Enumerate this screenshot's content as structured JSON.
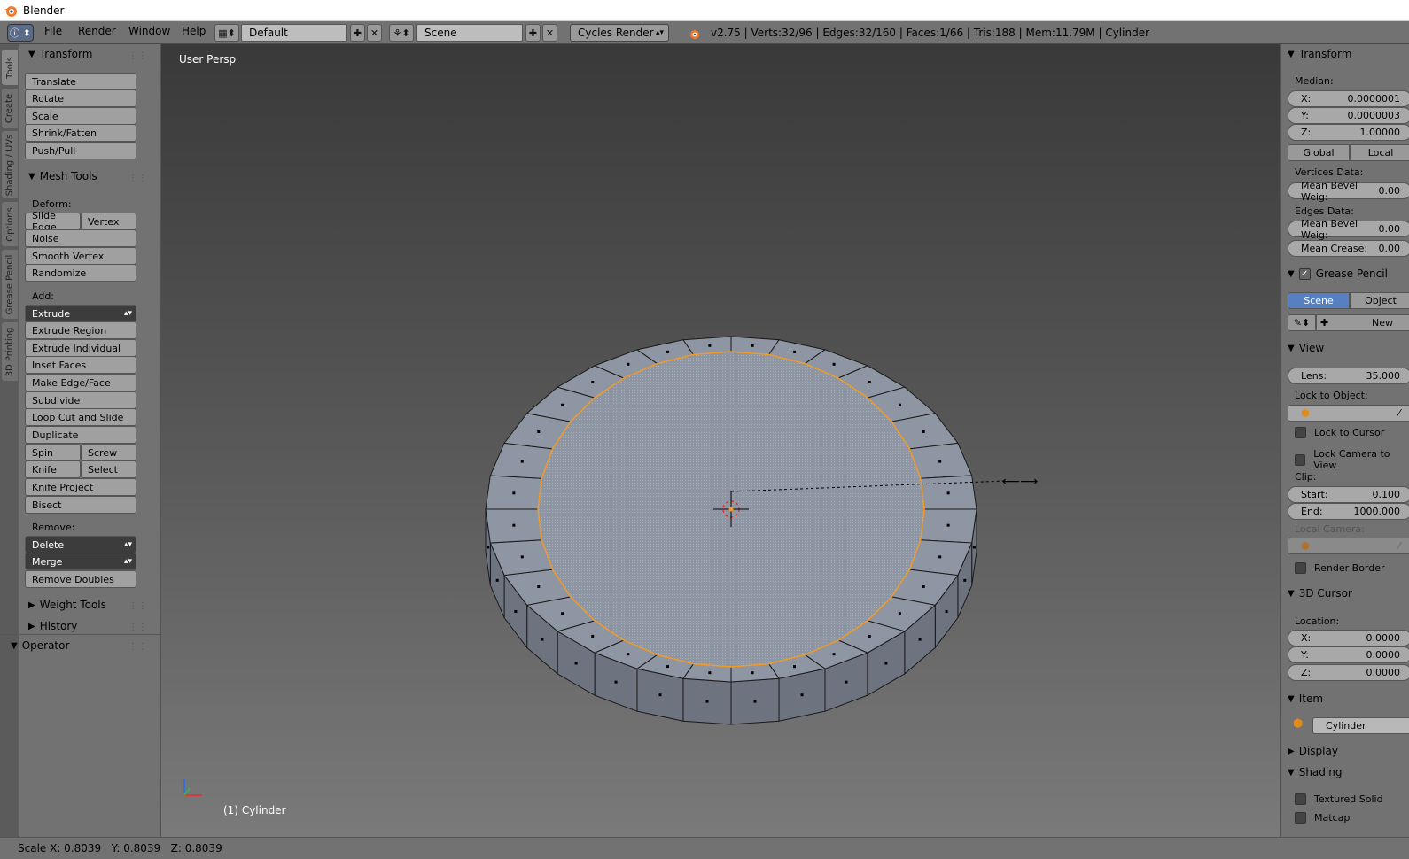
{
  "window": {
    "title": "Blender"
  },
  "menu": {
    "file": "File",
    "render": "Render",
    "window": "Window",
    "help": "Help"
  },
  "layout": {
    "screen_name": "Default",
    "scene_name": "Scene",
    "render_engine": "Cycles Render"
  },
  "stats": "v2.75 | Verts:32/96 | Edges:32/160 | Faces:1/66 | Tris:188 | Mem:11.79M | Cylinder",
  "tabs": [
    "Tools",
    "Create",
    "Shading / UVs",
    "Options",
    "Grease Pencil",
    "3D Printing"
  ],
  "toolshelf": {
    "transform": {
      "title": "Transform",
      "buttons": [
        "Translate",
        "Rotate",
        "Scale",
        "Shrink/Fatten",
        "Push/Pull"
      ]
    },
    "mesh_tools": {
      "title": "Mesh Tools",
      "deform_label": "Deform:",
      "slide_edge": "Slide Edge",
      "vertex": "Vertex",
      "noise": "Noise",
      "smooth_vertex": "Smooth Vertex",
      "randomize": "Randomize",
      "add_label": "Add:",
      "extrude": "Extrude",
      "extrude_region": "Extrude Region",
      "extrude_individual": "Extrude Individual",
      "inset_faces": "Inset Faces",
      "make_edge_face": "Make Edge/Face",
      "subdivide": "Subdivide",
      "loop_cut": "Loop Cut and Slide",
      "duplicate": "Duplicate",
      "spin": "Spin",
      "screw": "Screw",
      "knife": "Knife",
      "select": "Select",
      "knife_project": "Knife Project",
      "bisect": "Bisect",
      "remove_label": "Remove:",
      "delete": "Delete",
      "merge": "Merge",
      "remove_doubles": "Remove Doubles"
    },
    "weight_tools": "Weight Tools",
    "history": "History",
    "operator": "Operator"
  },
  "viewport": {
    "view_label": "User Persp",
    "object_label": "(1) Cylinder"
  },
  "properties": {
    "transform_title": "Transform",
    "median_label": "Median:",
    "median_x": {
      "label": "X:",
      "value": "0.0000001"
    },
    "median_y": {
      "label": "Y:",
      "value": "0.0000003"
    },
    "median_z": {
      "label": "Z:",
      "value": "1.00000"
    },
    "global": "Global",
    "local": "Local",
    "vertices_data_label": "Vertices Data:",
    "mean_bevel_weight_v": {
      "label": "Mean Bevel Weig:",
      "value": "0.00"
    },
    "edges_data_label": "Edges Data:",
    "mean_bevel_weight_e": {
      "label": "Mean Bevel Weig:",
      "value": "0.00"
    },
    "mean_crease": {
      "label": "Mean Crease:",
      "value": "0.00"
    },
    "grease_pencil_title": "Grease Pencil",
    "gp_scene": "Scene",
    "gp_object": "Object",
    "gp_new": "New",
    "view_title": "View",
    "lens": {
      "label": "Lens:",
      "value": "35.000"
    },
    "lock_to_object_label": "Lock to Object:",
    "lock_to_cursor": "Lock to Cursor",
    "lock_camera_to_view": "Lock Camera to View",
    "clip_label": "Clip:",
    "clip_start": {
      "label": "Start:",
      "value": "0.100"
    },
    "clip_end": {
      "label": "End:",
      "value": "1000.000"
    },
    "local_camera_label": "Local Camera:",
    "render_border": "Render Border",
    "cursor_title": "3D Cursor",
    "location_label": "Location:",
    "cursor_x": {
      "label": "X:",
      "value": "0.0000"
    },
    "cursor_y": {
      "label": "Y:",
      "value": "0.0000"
    },
    "cursor_z": {
      "label": "Z:",
      "value": "0.0000"
    },
    "item_title": "Item",
    "item_name": "Cylinder",
    "display_title": "Display",
    "shading_title": "Shading",
    "textured_solid": "Textured Solid",
    "matcap": "Matcap"
  },
  "statusbar": "Scale X: 0.8039   Y: 0.8039   Z: 0.8039",
  "colors": {
    "selection_orange": "#f39a27",
    "accent_blue": "#5680c2",
    "mesh_face": "#8f96a3"
  }
}
